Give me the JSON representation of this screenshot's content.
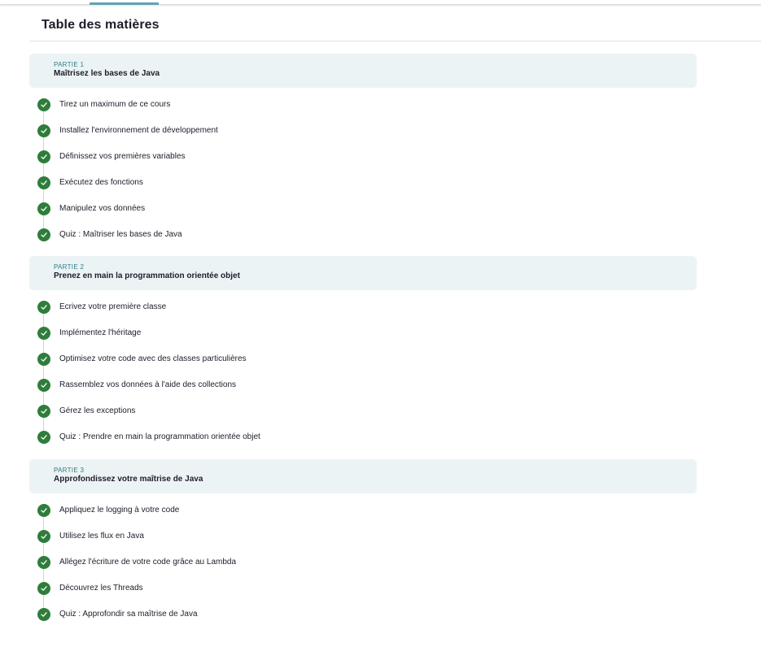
{
  "title": "Table des matières",
  "colors": {
    "check": "#2e7d3a",
    "kicker": "#2f7c87",
    "header_bg": "#ecf3f5"
  },
  "parts": [
    {
      "kicker": "PARTIE 1",
      "name": "Maîtrisez les bases de Java",
      "chapters": [
        {
          "label": "Tirez un maximum de ce cours",
          "icon": "check-icon",
          "completed": true
        },
        {
          "label": "Installez l'environnement de développement",
          "icon": "check-icon",
          "completed": true
        },
        {
          "label": "Définissez vos premières variables",
          "icon": "check-icon",
          "completed": true
        },
        {
          "label": "Exécutez des fonctions",
          "icon": "check-icon",
          "completed": true
        },
        {
          "label": "Manipulez vos données",
          "icon": "check-icon",
          "completed": true
        },
        {
          "label": "Quiz : Maîtriser les bases de Java",
          "icon": "check-icon",
          "completed": true
        }
      ]
    },
    {
      "kicker": "PARTIE 2",
      "name": "Prenez en main la programmation orientée objet",
      "chapters": [
        {
          "label": "Ecrivez votre première classe",
          "icon": "check-icon",
          "completed": true
        },
        {
          "label": "Implémentez l'héritage",
          "icon": "check-icon",
          "completed": true
        },
        {
          "label": "Optimisez votre code avec des classes particulières",
          "icon": "check-icon",
          "completed": true
        },
        {
          "label": "Rassemblez vos données à l'aide des collections",
          "icon": "check-icon",
          "completed": true
        },
        {
          "label": "Gérez les exceptions",
          "icon": "check-icon",
          "completed": true
        },
        {
          "label": "Quiz : Prendre en main la programmation orientée objet",
          "icon": "check-icon",
          "completed": true
        }
      ]
    },
    {
      "kicker": "PARTIE 3",
      "name": "Approfondissez votre maîtrise de Java",
      "chapters": [
        {
          "label": "Appliquez le logging à votre code",
          "icon": "check-icon",
          "completed": true
        },
        {
          "label": "Utilisez les flux en Java",
          "icon": "check-icon",
          "completed": true
        },
        {
          "label": "Allégez l'écriture de votre code grâce au Lambda",
          "icon": "check-icon",
          "completed": true
        },
        {
          "label": "Découvrez les Threads",
          "icon": "check-icon",
          "completed": true
        },
        {
          "label": "Quiz : Approfondir sa maîtrise de Java",
          "icon": "check-icon",
          "completed": true
        }
      ]
    }
  ]
}
